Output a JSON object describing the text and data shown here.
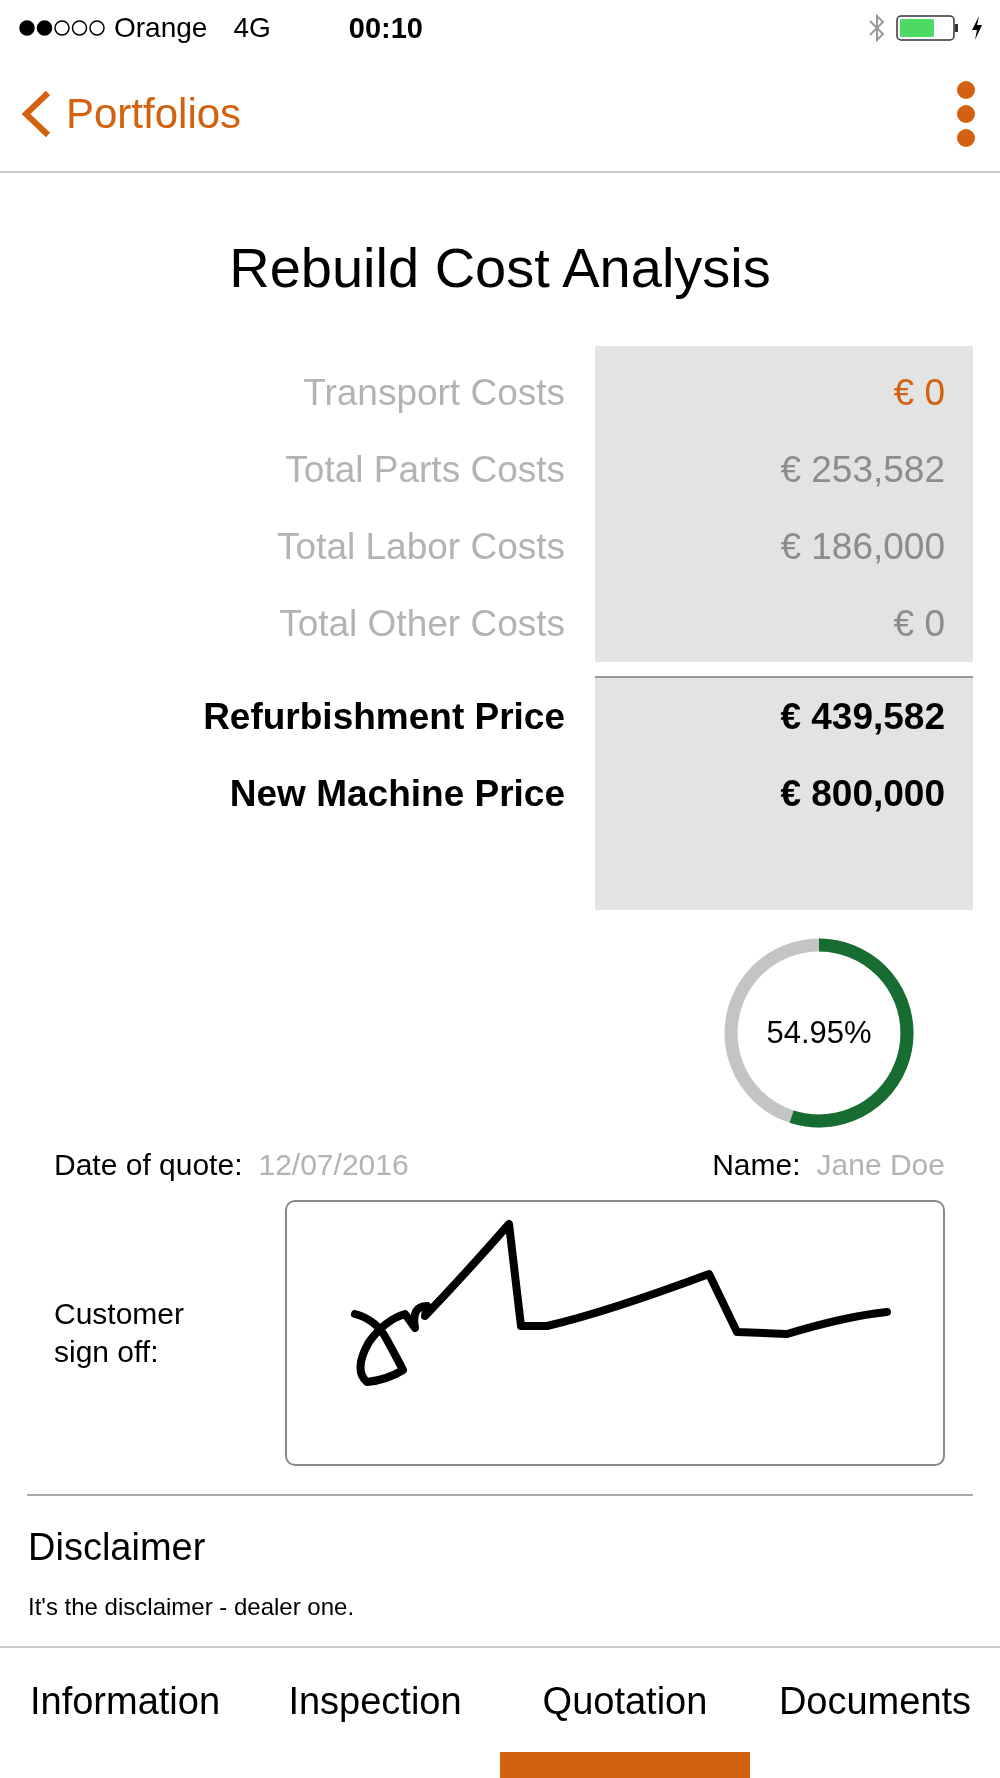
{
  "status_bar": {
    "carrier": "Orange",
    "network": "4G",
    "time": "00:10"
  },
  "nav": {
    "back_label": "Portfolios"
  },
  "title": "Rebuild Cost Analysis",
  "costs": [
    {
      "kind": "editable",
      "label": "Transport Costs",
      "value": "€ 0"
    },
    {
      "kind": "computed",
      "label": "Total Parts Costs",
      "value": "€ 253,582"
    },
    {
      "kind": "computed",
      "label": "Total Labor Costs",
      "value": "€ 186,000"
    },
    {
      "kind": "computed",
      "label": "Total Other Costs",
      "value": "€ 0"
    },
    {
      "kind": "total",
      "label": "Refurbishment Price",
      "value": "€ 439,582"
    },
    {
      "kind": "total",
      "label": "New Machine Price",
      "value": "€ 800,000"
    }
  ],
  "ratio": {
    "level": 0.5495,
    "reading": "54.95%"
  },
  "quote": {
    "date_label": "Date of quote:",
    "date": "12/07/2016",
    "name_label": "Name:",
    "name": "Jane Doe"
  },
  "signature": {
    "label": "Customer sign off:"
  },
  "disclaimer": {
    "title": "Disclaimer",
    "text": "It's the disclaimer - dealer one."
  },
  "tabs": [
    {
      "label": "Information",
      "selected": false
    },
    {
      "label": "Inspection",
      "selected": false
    },
    {
      "label": "Quotation",
      "selected": true
    },
    {
      "label": "Documents",
      "selected": false
    }
  ]
}
